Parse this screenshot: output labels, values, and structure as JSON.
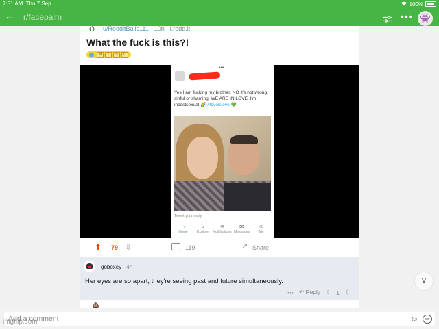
{
  "status_bar": {
    "time": "7:51 AM",
    "date": "Thu 7 Sep",
    "battery": "100%",
    "icons": [
      "wifi-icon",
      "battery-icon"
    ]
  },
  "header": {
    "subreddit": "r/facepalm",
    "icons": [
      "back-arrow-icon",
      "filter-icon",
      "more-icon",
      "profile-avatar"
    ]
  },
  "post": {
    "author": "u/RedditBalls111",
    "age": "10h",
    "domain": "i.redd.it",
    "title": "What the fuck is this?!",
    "flair_letters": [
      "M",
      "I",
      "S",
      "C"
    ],
    "tweet": {
      "text": "Yes I am fucking my brother. NO it's not wrong, sinful or shaming. WE ARE IN LOVE. I'm incestsexual 🌈 ",
      "hashtag": "#loveislove",
      "reply_placeholder": "Tweet your reply",
      "nav": [
        "Home",
        "Explore",
        "Notifications",
        "Messages",
        "Me"
      ]
    },
    "votes": "79",
    "comments": "119",
    "share_label": "Share"
  },
  "comment": {
    "user": "goboxey",
    "age": "4h",
    "text": "Her eyes are so apart, they're seeing past and future simultaneously.",
    "reply_label": "Reply",
    "votes": "1"
  },
  "composer": {
    "placeholder": "Add a comment"
  },
  "watermark": "imgflip.com",
  "colors": {
    "header_green": "#46b544",
    "upvote": "#ff4500",
    "link": "#6b8fb5",
    "comment_bg": "#e6ebf1"
  }
}
